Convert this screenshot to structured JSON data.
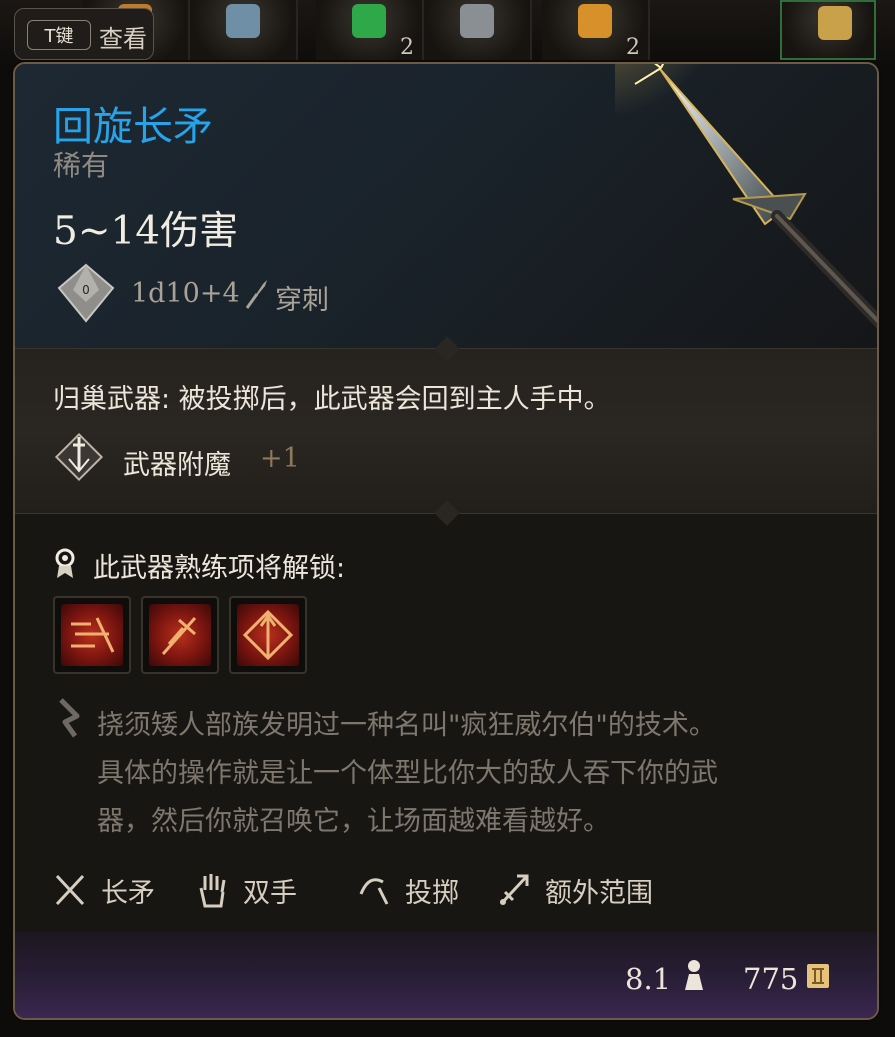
{
  "inventory": {
    "slots": [
      {
        "icon": "potion-flask-icon",
        "quantity": ""
      },
      {
        "icon": "scroll-icon",
        "quantity": ""
      },
      {
        "icon": "green-potion-icon",
        "quantity": "2"
      },
      {
        "icon": "hammer-icon",
        "quantity": ""
      },
      {
        "icon": "scroll-sun-icon",
        "quantity": "2"
      },
      {
        "icon": "axe-icon",
        "quantity": ""
      }
    ]
  },
  "key_hint": {
    "key": "T键",
    "label": "查看"
  },
  "item": {
    "name": "回旋长矛",
    "rarity": "稀有",
    "damage": "5~14伤害",
    "dice": "1d10+4",
    "damage_type": "穿刺",
    "property": "归巢武器: 被投掷后，此武器会回到主人手中。",
    "enchantment": {
      "label": "武器附魔",
      "bonus": "+1"
    },
    "proficiency_unlock": "此武器熟练项将解锁:",
    "actions": [
      {
        "icon": "piercing-strike-icon"
      },
      {
        "icon": "concussive-smash-icon"
      },
      {
        "icon": "flourish-icon"
      }
    ],
    "lore": [
      "挠须矮人部族发明过一种名叫\"疯狂威尔伯\"的技术。",
      "具体的操作就是让一个体型比你大的敌人吞下你的武",
      "器，然后你就召唤它，让场面越难看越好。"
    ],
    "tags": [
      {
        "label": "长矛",
        "icon": "crossed-spears-icon"
      },
      {
        "label": "双手",
        "icon": "hand-icon"
      },
      {
        "label": "投掷",
        "icon": "throw-arc-icon"
      },
      {
        "label": "额外范围",
        "icon": "reach-icon"
      }
    ],
    "weight": "8.1",
    "value": "775"
  },
  "colors": {
    "rare_name": "#27a3e8",
    "panel_border": "#6b5a44",
    "footer_purple": "#3c2752"
  }
}
